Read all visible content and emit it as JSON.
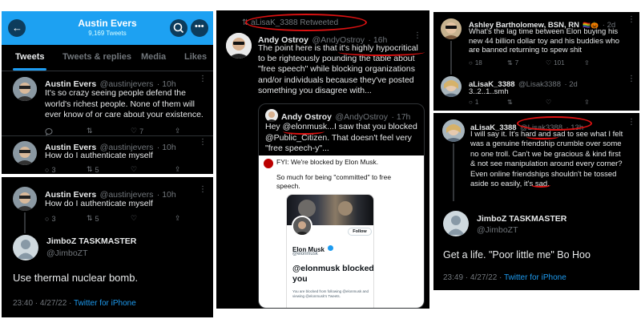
{
  "panel1": {
    "header": {
      "name": "Austin Evers",
      "count": "9,169 Tweets"
    },
    "tabs": [
      "Tweets",
      "Tweets & replies",
      "Media",
      "Likes"
    ],
    "tweet1": {
      "name": "Austin Evers",
      "handle": "@austinjevers",
      "time": "· 10h",
      "text": "It's so crazy seeing people defend the world's richest people. None of them will ever know of or care about your existence.",
      "likes": "7"
    },
    "tweet2": {
      "name": "Austin Evers",
      "handle": "@austinjevers",
      "time": "· 10h",
      "text": "How do I authenticate myself",
      "replies": "3",
      "retweets": "5"
    }
  },
  "panel2": {
    "tweet": {
      "name": "Austin Evers",
      "handle": "@austinjevers",
      "time": "· 10h",
      "text": "How do I authenticate myself",
      "replies": "3",
      "retweets": "5"
    },
    "reply": {
      "name": "JimboZ TASKMASTER",
      "handle": "@JimboZT",
      "text": "Use  thermal nuclear bomb.",
      "timestamp": "23:40 · 4/27/22 · ",
      "source": "Twitter for iPhone"
    }
  },
  "panel3": {
    "retweeted": "aLisaK_3388 Retweeted",
    "tweet": {
      "name": "Andy Ostroy",
      "handle": "@AndyOstroy",
      "time": "· 16h",
      "text_lines": [
        "The point here is that it's highly hypocritical",
        "to be righteously pounding the table about",
        "\"free speech\" while blocking organizations",
        "and/or individuals because they've posted",
        "something you disagree with..."
      ]
    },
    "quote": {
      "name": "Andy Ostroy",
      "handle": "@AndyOstroy",
      "time": "· 17h",
      "text_lines": [
        "Hey @elonmusk...I saw that you blocked",
        "@Public_Citizen. That doesn't feel very",
        "\"free speech-y\"..."
      ],
      "fyi_lines": [
        "FYI: We're blocked by Elon Musk."
      ],
      "committed_lines": [
        "So much for being \"committed\" to free",
        "speech."
      ]
    },
    "inner": {
      "follow": "Follow",
      "name": "Elon Musk",
      "handle": "@elonmusk",
      "blocked_title_lines": [
        "@elonmusk blocked",
        "you"
      ],
      "blocked_desc_lines": [
        "You are blocked from following @elonmusk and",
        "viewing @elonmusk's Tweets."
      ]
    }
  },
  "panel4": {
    "tweet1": {
      "name": "Ashley Bartholomew, BSN, RN",
      "time": "· 2d",
      "text_lines": [
        "What's the lag time between Elon buying his",
        "new 44 billion dollar toy and his buddies who",
        "are banned returning to spew shit"
      ],
      "replies": "18",
      "retweets": "7",
      "likes": "101"
    },
    "tweet2": {
      "name": "aLisaK_3388",
      "handle": "@Lisak3388",
      "time": "· 2d",
      "text": "3..2..1..smh",
      "replies": "1"
    }
  },
  "panel5": {
    "tweet": {
      "name": "aLisaK_3388",
      "handle": "@Lisak3388",
      "time": "· 13h",
      "text_lines": [
        "I will say it. It's hard and sad to see what I felt",
        "was a genuine friendship crumble over some",
        "no one troll. Can't we be gracious & kind first",
        "& not see manipulation around every corner?",
        "Even online friendships shouldn't be tossed",
        "aside so easily, it's  sad."
      ]
    },
    "reply": {
      "name": "JimboZ TASKMASTER",
      "handle": "@JimboZT",
      "text": "Get a life. \"Poor little me\" Bo Hoo",
      "timestamp": "23:49 · 4/27/22 · ",
      "source": "Twitter for iPhone"
    }
  },
  "colors": {
    "twitter_blue": "#1d9bf0",
    "annotation_red": "#d11111",
    "background": "#000000"
  }
}
